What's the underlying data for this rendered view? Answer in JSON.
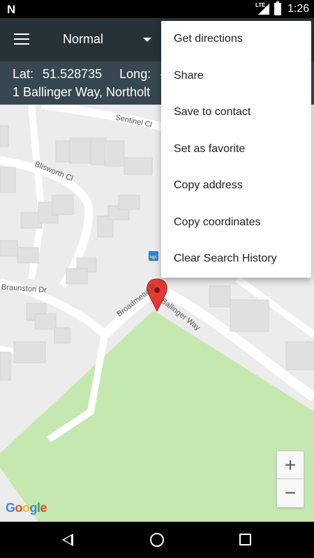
{
  "status_bar": {
    "notification_icon": "N",
    "network": "LTE",
    "time": "1:26"
  },
  "app_bar": {
    "menu_icon": "hamburger-menu-icon",
    "map_type": "Normal"
  },
  "location": {
    "lat_label": "Lat:",
    "lat_value": "51.528735",
    "long_label": "Long:",
    "long_value": "-",
    "address": "1 Ballinger Way, Northolt"
  },
  "map": {
    "streets": [
      "Sentinel Cl",
      "Blisworth Cl",
      "Braunston Dr",
      "Broadmead R",
      "Ballinger Way"
    ],
    "zoom_in_label": "+",
    "zoom_out_label": "−",
    "logo": "Google",
    "colors": {
      "park": "#c5e8b0",
      "road": "#ffffff",
      "background": "#ececec",
      "marker": "#e53935"
    }
  },
  "menu": {
    "items": [
      {
        "label": "Get directions"
      },
      {
        "label": "Share"
      },
      {
        "label": "Save to contact"
      },
      {
        "label": "Set as favorite"
      },
      {
        "label": "Copy address"
      },
      {
        "label": "Copy coordinates"
      },
      {
        "label": "Clear Search History"
      }
    ]
  },
  "nav_bar": {
    "back_icon": "back-icon",
    "home_icon": "home-icon",
    "recent_icon": "recent-apps-icon"
  }
}
